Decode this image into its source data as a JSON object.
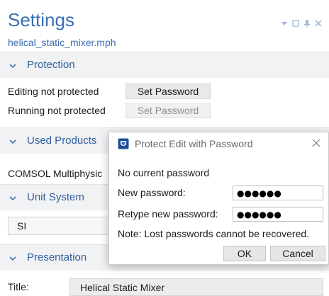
{
  "header": {
    "title": "Settings",
    "filename": "helical_static_mixer.mph"
  },
  "protection": {
    "section_label": "Protection",
    "editing_status": "Editing not protected",
    "editing_button": "Set Password",
    "running_status": "Running not protected",
    "running_button": "Set Password"
  },
  "used_products": {
    "section_label": "Used Products",
    "product": "COMSOL Multiphysic"
  },
  "unit_system": {
    "section_label": "Unit System",
    "value": "SI"
  },
  "presentation": {
    "section_label": "Presentation",
    "title_label": "Title:",
    "title_value": "Helical Static Mixer"
  },
  "dialog": {
    "title": "Protect Edit with Password",
    "status": "No current password",
    "new_password_label": "New password:",
    "new_password_value": "●●●●●●",
    "retype_label": "Retype new password:",
    "retype_value": "●●●●●●",
    "note": "Note: Lost passwords cannot be recovered.",
    "ok_label": "OK",
    "cancel_label": "Cancel"
  },
  "colors": {
    "accent": "#3a6db5",
    "section_bg": "#f1f2f4"
  }
}
